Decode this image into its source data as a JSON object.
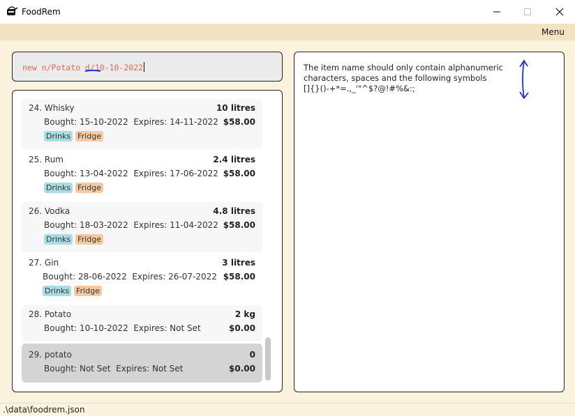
{
  "window": {
    "title": "FoodRem",
    "minimize_glyph": "—",
    "maximize_glyph": "☐",
    "close_glyph": "✕"
  },
  "menu": {
    "label": "Menu"
  },
  "command": {
    "value_prefix": "new n/Potato ",
    "value_suffix": "d/10-10-2022"
  },
  "items": [
    {
      "index_name": "24.  Whisky",
      "quantity": "10 litres",
      "bought": "Bought: 15-10-2022",
      "expires": "Expires: 14-11-2022",
      "price": "$58.00",
      "tags": [
        "Drinks",
        "Fridge"
      ]
    },
    {
      "index_name": "25.  Rum",
      "quantity": "2.4 litres",
      "bought": "Bought: 13-04-2022",
      "expires": "Expires: 17-06-2022",
      "price": "$58.00",
      "tags": [
        "Drinks",
        "Fridge"
      ]
    },
    {
      "index_name": "26.  Vodka",
      "quantity": "4.8 litres",
      "bought": "Bought: 18-03-2022",
      "expires": "Expires: 11-04-2022",
      "price": "$58.00",
      "tags": [
        "Drinks",
        "Fridge"
      ]
    },
    {
      "index_name": "27.  Gin",
      "quantity": "3 litres",
      "bought": "Bought: 28-06-2022",
      "expires": "Expires: 26-07-2022",
      "price": "$58.00",
      "tags": [
        "Drinks",
        "Fridge"
      ]
    },
    {
      "index_name": "28.  Potato",
      "quantity": "2 kg",
      "bought": "Bought: 10-10-2022",
      "expires": "Expires: Not Set",
      "price": "$0.00",
      "tags": []
    },
    {
      "index_name": "29.  potato",
      "quantity": "0",
      "bought": "Bought: Not Set",
      "expires": "Expires: Not Set",
      "price": "$0.00",
      "tags": []
    }
  ],
  "result": {
    "line1": "The item name should only contain alphanumeric",
    "line2": "characters, spaces and the following symbols",
    "line3": "[]{}()-+*=.,_'\"^$?@!#%&:;"
  },
  "status": {
    "path": ".\\data\\foodrem.json"
  },
  "colors": {
    "background": "#fcf3df",
    "menubar": "#f3e3c3",
    "command_text": "#e06a54",
    "tag_drinks": "#a9dce3",
    "tag_fridge": "#f3caa3",
    "selected_card": "#d4d4d4",
    "annotation": "#1a2fd6"
  }
}
